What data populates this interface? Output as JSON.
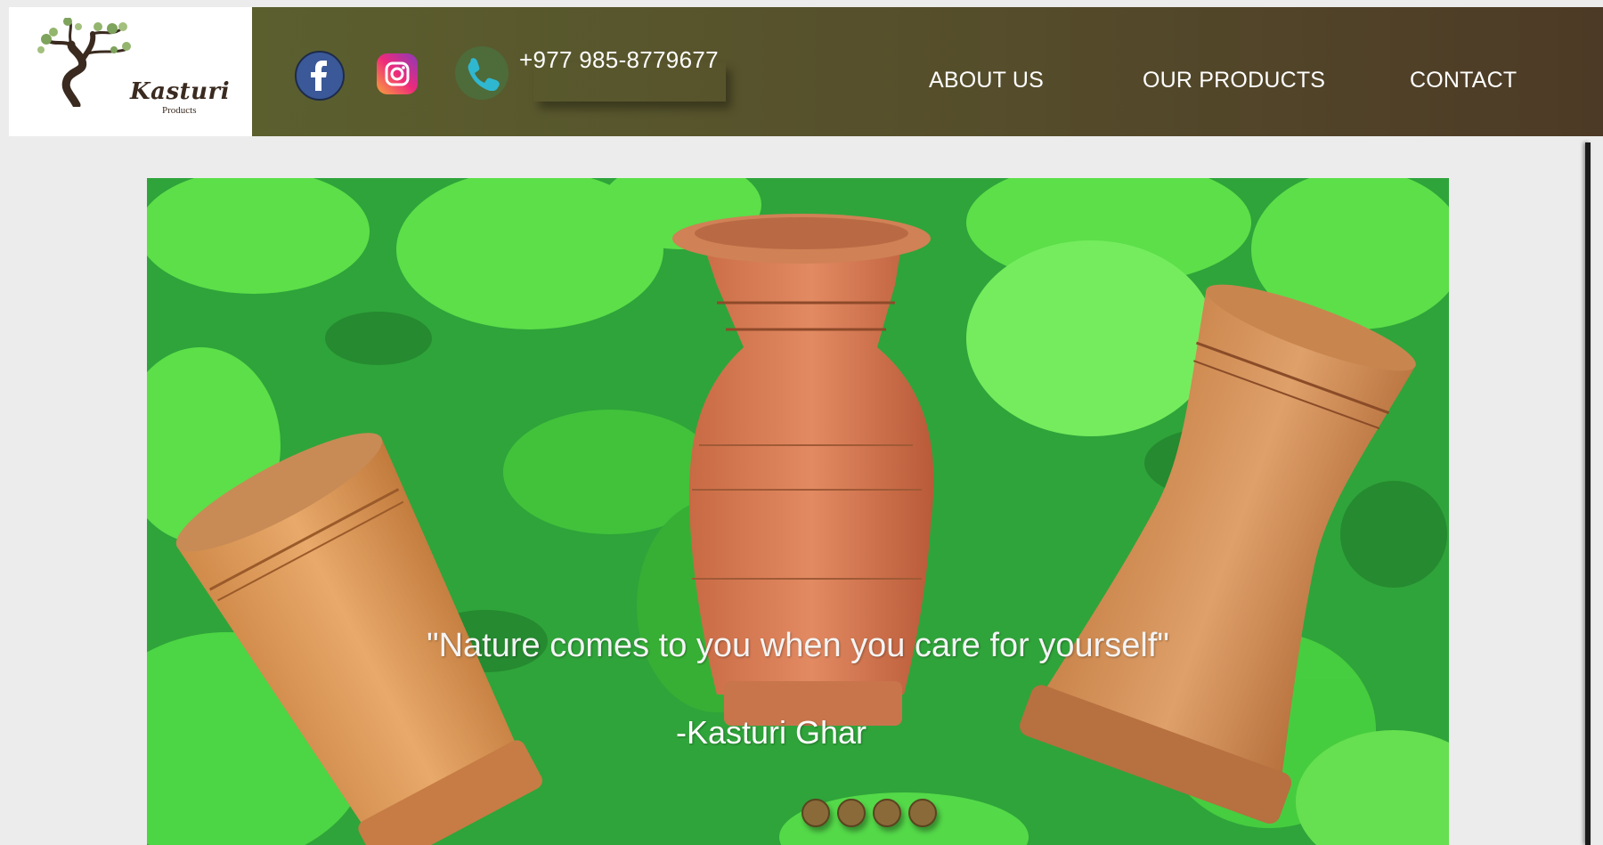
{
  "brand": {
    "name": "Kasturi",
    "sub": "Products",
    "logo_icon": "tree-icon"
  },
  "header": {
    "social": [
      {
        "name": "facebook",
        "icon": "facebook-icon",
        "color": "#3b5998"
      },
      {
        "name": "instagram",
        "icon": "instagram-icon",
        "color": "#ee2a7b"
      },
      {
        "name": "phone",
        "icon": "phone-icon",
        "color": "#4e6b3a"
      }
    ],
    "phone": "+977 985-8779677",
    "nav": {
      "about": "ABOUT US",
      "products": "OUR PRODUCTS",
      "contact": "CONTACT"
    }
  },
  "hero": {
    "quote": "\"Nature comes to you when you care for yourself\"",
    "author": "-Kasturi Ghar",
    "slide_count": 4
  },
  "colors": {
    "header_bg_start": "#5b5f2e",
    "header_bg_end": "#4d3a26",
    "page_bg": "#ececec",
    "dot": "#8b6a3a"
  }
}
